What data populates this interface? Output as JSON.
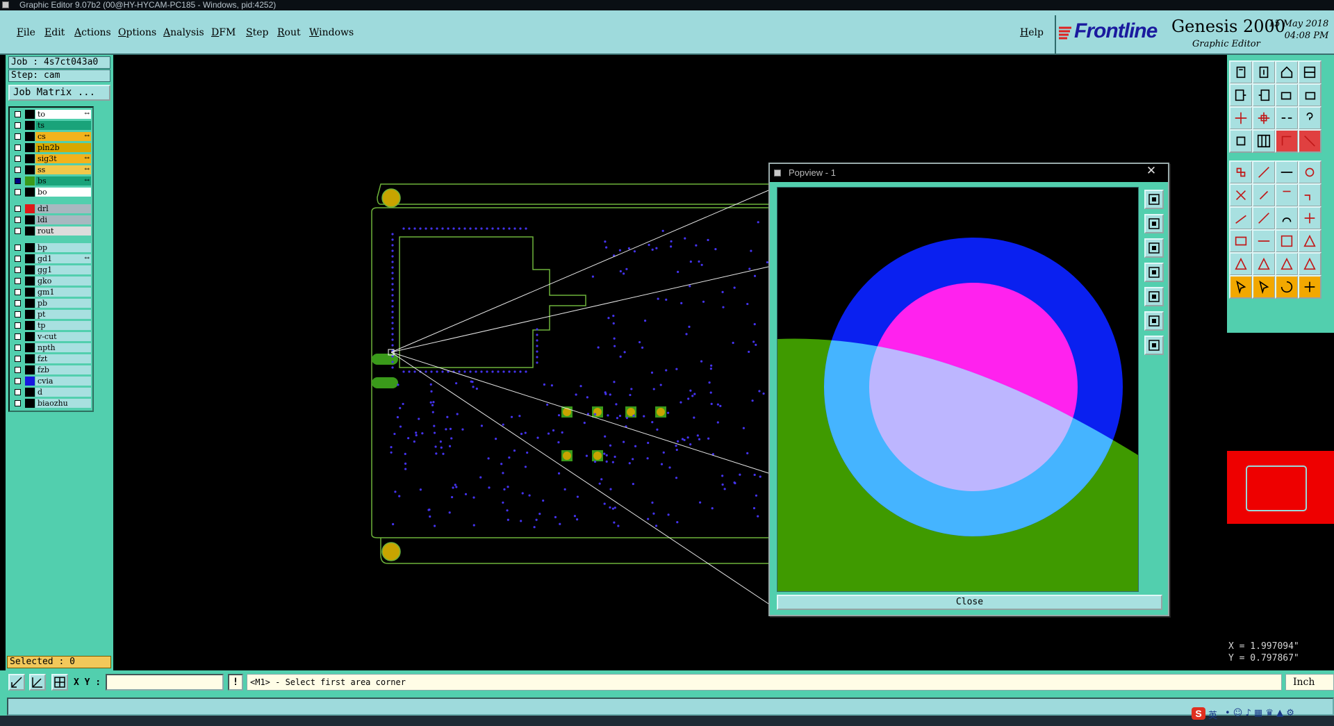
{
  "window": {
    "title": "Graphic Editor 9.07b2 (00@HY-HYCAM-PC185 - Windows, pid:4252)"
  },
  "menu": {
    "items": [
      "File",
      "Edit",
      "Actions",
      "Options",
      "Analysis",
      "DFM",
      "Step",
      "Rout",
      "Windows"
    ],
    "help": "Help"
  },
  "brand": {
    "logo": "Frontline",
    "product": "Genesis 2000",
    "subtitle": "Graphic Editor",
    "date": "15 May 2018",
    "time": "04:08 PM"
  },
  "job": {
    "job_line": "Job : 4s7ct043a0",
    "step_line": "Step: cam",
    "job_matrix_label": "Job Matrix ..."
  },
  "layers": [
    {
      "name": "to",
      "color": "#ffffff",
      "swatch": "#000000",
      "mark": "↔"
    },
    {
      "name": "ts",
      "color": "#1aa37a",
      "swatch": "#000000",
      "mark": ""
    },
    {
      "name": "cs",
      "color": "#f2b31c",
      "swatch": "#000000",
      "mark": "↔"
    },
    {
      "name": "pln2b",
      "color": "#d8a800",
      "swatch": "#000000",
      "mark": ""
    },
    {
      "name": "sig3t",
      "color": "#f2b31c",
      "swatch": "#000000",
      "mark": "↔"
    },
    {
      "name": "ss",
      "color": "#f2c84a",
      "swatch": "#000000",
      "mark": "↔"
    },
    {
      "name": "bs",
      "color": "#1aa37a",
      "swatch": "#3a9a1a",
      "mark": "↔"
    },
    {
      "name": "bo",
      "color": "#ffffff",
      "swatch": "#000000",
      "mark": ""
    },
    {
      "name": "drl",
      "color": "#a8b8c0",
      "swatch": "#e01818",
      "mark": ""
    },
    {
      "name": "ldi",
      "color": "#a8b8c0",
      "swatch": "#000000",
      "mark": ""
    },
    {
      "name": "rout",
      "color": "#dcdcdc",
      "swatch": "#000000",
      "mark": ""
    },
    {
      "name": "bp",
      "color": "#a8e0e0",
      "swatch": "#000000",
      "mark": ""
    },
    {
      "name": "gd1",
      "color": "#a8e0e0",
      "swatch": "#000000",
      "mark": "↔"
    },
    {
      "name": "gg1",
      "color": "#a8e0e0",
      "swatch": "#000000",
      "mark": ""
    },
    {
      "name": "gko",
      "color": "#a8e0e0",
      "swatch": "#000000",
      "mark": ""
    },
    {
      "name": "gm1",
      "color": "#a8e0e0",
      "swatch": "#000000",
      "mark": ""
    },
    {
      "name": "pb",
      "color": "#a8e0e0",
      "swatch": "#000000",
      "mark": ""
    },
    {
      "name": "pt",
      "color": "#a8e0e0",
      "swatch": "#000000",
      "mark": ""
    },
    {
      "name": "tp",
      "color": "#a8e0e0",
      "swatch": "#000000",
      "mark": ""
    },
    {
      "name": "v-cut",
      "color": "#a8e0e0",
      "swatch": "#000000",
      "mark": ""
    },
    {
      "name": "npth",
      "color": "#a8e0e0",
      "swatch": "#000000",
      "mark": ""
    },
    {
      "name": "fzt",
      "color": "#a8e0e0",
      "swatch": "#000000",
      "mark": ""
    },
    {
      "name": "fzb",
      "color": "#a8e0e0",
      "swatch": "#000000",
      "mark": ""
    },
    {
      "name": "cvia",
      "color": "#a8e0e0",
      "swatch": "#1818e0",
      "mark": ""
    },
    {
      "name": "d",
      "color": "#a8e0e0",
      "swatch": "#000000",
      "mark": ""
    },
    {
      "name": "biaozhu",
      "color": "#a8e0e0",
      "swatch": "#000000",
      "mark": ""
    }
  ],
  "status": {
    "selected": "Selected : 0",
    "xy_label": "X Y :",
    "xy_value": "",
    "exclaim": "!",
    "prompt": "<M1> - Select first area corner",
    "units": "Inch",
    "x_coord": "X = 1.997094\"",
    "y_coord": "Y = 0.797867\""
  },
  "popview": {
    "title": "Popview - 1",
    "close_x": "✕",
    "close_button": "Close"
  },
  "tray": {
    "ime_label": "英"
  },
  "colors": {
    "panel": "#52cfae",
    "menu": "#9edadc",
    "board_outline": "#6db33a",
    "pad": "#c8a400",
    "via": "#4433ee",
    "pop_green": "#3f9a00",
    "pop_blue": "#0a20f0",
    "pop_lightblue": "#45b4ff",
    "pop_magenta": "#ff22ee",
    "pop_lavender": "#bdb6ff"
  }
}
